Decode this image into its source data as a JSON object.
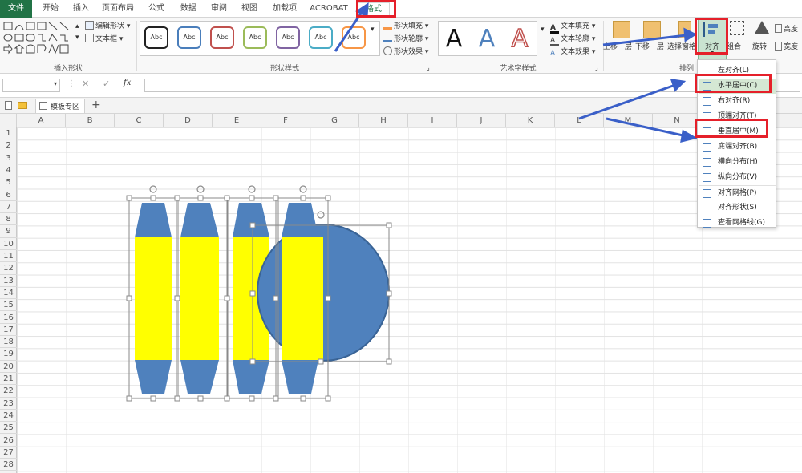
{
  "tabs": [
    {
      "label": "文件"
    },
    {
      "label": "开始"
    },
    {
      "label": "插入"
    },
    {
      "label": "页面布局"
    },
    {
      "label": "公式"
    },
    {
      "label": "数据"
    },
    {
      "label": "审阅"
    },
    {
      "label": "视图"
    },
    {
      "label": "加载项"
    },
    {
      "label": "ACROBAT"
    },
    {
      "label": "格式"
    }
  ],
  "ribbon": {
    "insert_shapes": {
      "label": "插入形状",
      "edit_shape": "编辑形状",
      "text_box": "文本框"
    },
    "shape_styles": {
      "label": "形状样式",
      "sample": "Abc",
      "fill": "形状填充",
      "outline": "形状轮廓",
      "effects": "形状效果",
      "border_colors": [
        "#222222",
        "#4a7ebb",
        "#c0504d",
        "#9bbb59",
        "#8064a2",
        "#4bacc6",
        "#f79646"
      ]
    },
    "wordart": {
      "label": "艺术字样式",
      "letter": "A",
      "text_fill": "文本填充",
      "text_outline": "文本轮廓",
      "text_effects": "文本效果"
    },
    "arrange": {
      "label": "排列",
      "bring_forward": "上移一层",
      "send_backward": "下移一层",
      "selection_pane": "选择窗格",
      "align": "对齐",
      "group": "组合",
      "rotate": "旋转"
    },
    "size": {
      "height": "高度",
      "width": "宽度"
    }
  },
  "formula_bar": {
    "fx": "fx",
    "cancel": "✕",
    "confirm": "✓"
  },
  "doc_tabs": {
    "template_zone": "模板专区",
    "add": "+"
  },
  "columns": [
    "A",
    "B",
    "C",
    "D",
    "E",
    "F",
    "G",
    "H",
    "I",
    "J",
    "K",
    "L",
    "M",
    "N"
  ],
  "rows": [
    "1",
    "2",
    "3",
    "4",
    "5",
    "6",
    "7",
    "8",
    "9",
    "10",
    "11",
    "12",
    "13",
    "14",
    "15",
    "16",
    "17",
    "18",
    "19",
    "20",
    "21",
    "22",
    "23",
    "24",
    "25",
    "26",
    "27",
    "28"
  ],
  "align_menu": [
    {
      "label": "左对齐(L)",
      "highlight": false
    },
    {
      "label": "水平居中(C)",
      "highlight": true
    },
    {
      "label": "右对齐(R)",
      "highlight": false
    },
    {
      "label": "顶端对齐(T)",
      "highlight": false
    },
    {
      "label": "垂直居中(M)",
      "highlight": false
    },
    {
      "label": "底端对齐(B)",
      "highlight": false
    },
    {
      "label": "横向分布(H)",
      "highlight": false
    },
    {
      "label": "纵向分布(V)",
      "highlight": false
    },
    {
      "label": "对齐网格(P)",
      "highlight": false
    },
    {
      "label": "对齐形状(S)",
      "highlight": false
    },
    {
      "label": "查看网格线(G)",
      "highlight": false
    }
  ],
  "colors": {
    "accent_green": "#217346",
    "shape_blue": "#4f81bd",
    "shape_yellow": "#ffff00",
    "annotation_red": "#e5202a",
    "annotation_arrow": "#3a5fc8"
  }
}
